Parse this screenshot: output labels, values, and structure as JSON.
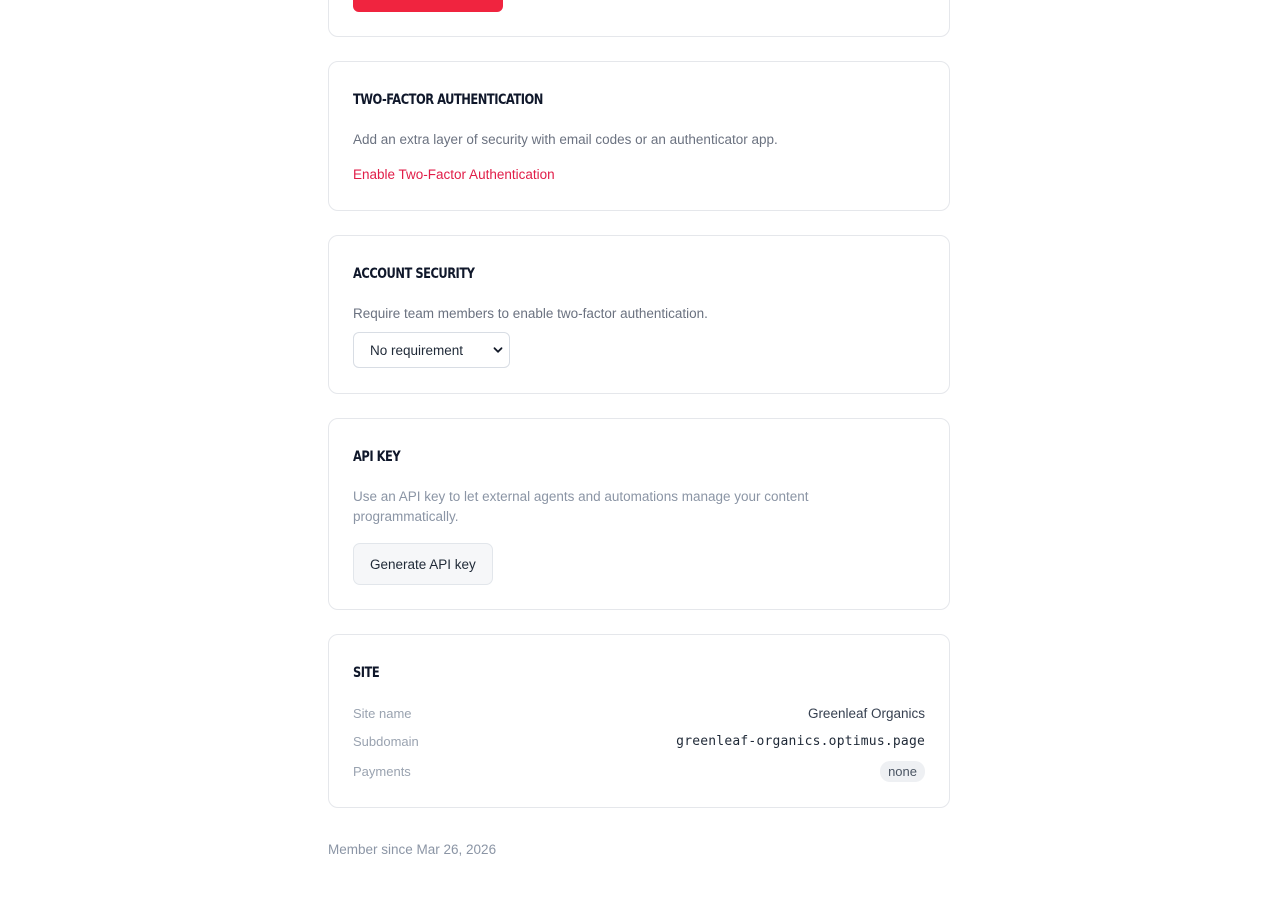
{
  "two_factor": {
    "title": "Two-Factor Authentication",
    "description": "Add an extra layer of security with email codes or an authenticator app.",
    "enable_link": "Enable Two-Factor Authentication"
  },
  "account_security": {
    "title": "Account Security",
    "description": "Require team members to enable two-factor authentication.",
    "select_value": "No requirement"
  },
  "api_key": {
    "title": "API Key",
    "description": "Use an API key to let external agents and automations manage your content programmatically.",
    "button_label": "Generate API key"
  },
  "site": {
    "title": "Site",
    "rows": [
      {
        "label": "Site name",
        "value": "Greenleaf Organics"
      },
      {
        "label": "Subdomain",
        "value": "greenleaf-organics.optimus.page"
      },
      {
        "label": "Payments",
        "value": "none"
      }
    ]
  },
  "footer": {
    "member_since": "Member since Mar 26, 2026"
  },
  "colors": {
    "accent_red": "#e11d48",
    "button_red": "#f0243f"
  },
  "icons": {
    "select_chevron": "chevron-down-icon"
  }
}
